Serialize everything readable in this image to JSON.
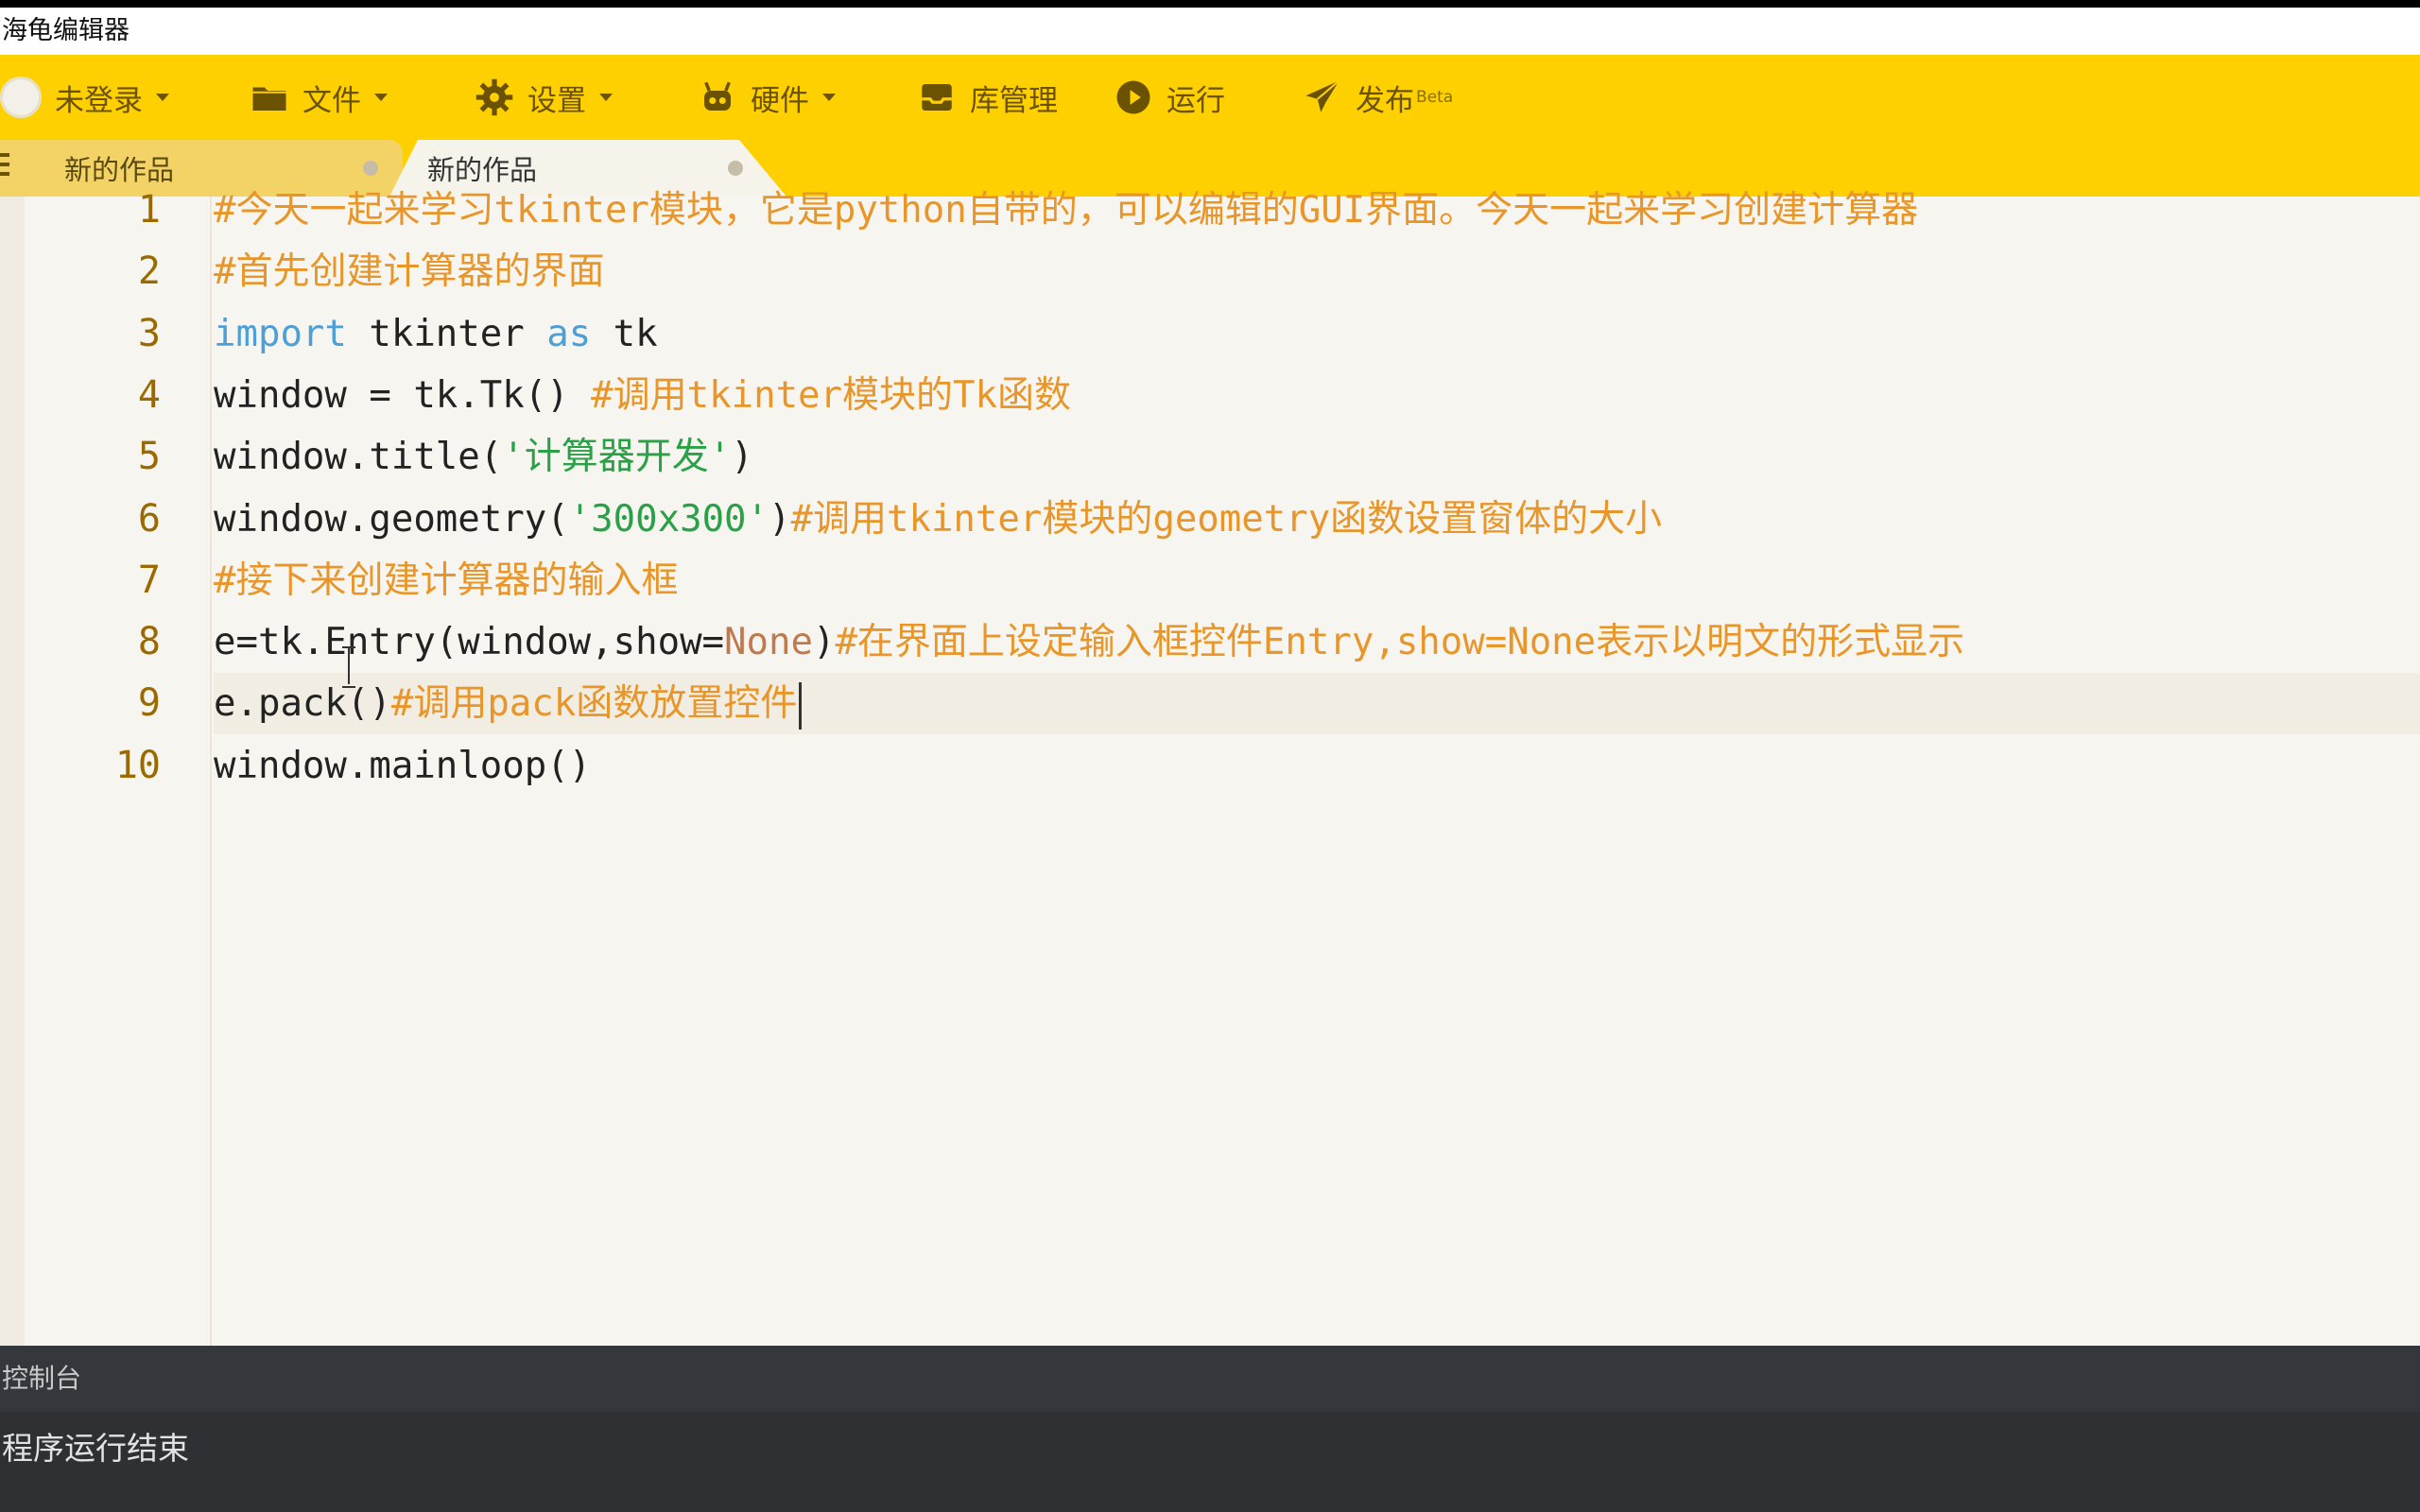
{
  "window": {
    "title": "海龟编辑器"
  },
  "toolbar": {
    "user": {
      "label": "未登录"
    },
    "file": {
      "label": "文件"
    },
    "settings": {
      "label": "设置"
    },
    "hardware": {
      "label": "硬件"
    },
    "library": {
      "label": "库管理"
    },
    "run": {
      "label": "运行"
    },
    "publish": {
      "label": "发布",
      "badge": "Beta"
    },
    "accent_color": "#ffd000"
  },
  "tabs": [
    {
      "label": "新的作品",
      "active": false
    },
    {
      "label": "新的作品",
      "active": true
    }
  ],
  "editor": {
    "line_numbers": [
      "1",
      "2",
      "3",
      "4",
      "5",
      "6",
      "7",
      "8",
      "9",
      "10"
    ],
    "lines": [
      [
        {
          "t": "#今天一起来学习tkinter模块，它是python自带的，可以编辑的GUI界面。今天一起来学习创建计算器",
          "k": "comment"
        }
      ],
      [
        {
          "t": "#首先创建计算器的界面",
          "k": "comment"
        }
      ],
      [
        {
          "t": "import",
          "k": "keyword"
        },
        {
          "t": " tkinter ",
          "k": "plain"
        },
        {
          "t": "as",
          "k": "keyword"
        },
        {
          "t": " tk",
          "k": "plain"
        }
      ],
      [
        {
          "t": "window = tk.Tk() ",
          "k": "plain"
        },
        {
          "t": "#调用tkinter模块的Tk函数",
          "k": "comment"
        }
      ],
      [
        {
          "t": "window.title(",
          "k": "plain"
        },
        {
          "t": "'计算器开发'",
          "k": "string"
        },
        {
          "t": ")",
          "k": "plain"
        }
      ],
      [
        {
          "t": "window.geometry(",
          "k": "plain"
        },
        {
          "t": "'300x300'",
          "k": "string"
        },
        {
          "t": ")",
          "k": "plain"
        },
        {
          "t": "#调用tkinter模块的geometry函数设置窗体的大小",
          "k": "comment"
        }
      ],
      [
        {
          "t": "#接下来创建计算器的输入框",
          "k": "comment"
        }
      ],
      [
        {
          "t": "e=tk.Entry(window,show=",
          "k": "plain"
        },
        {
          "t": "None",
          "k": "none"
        },
        {
          "t": ")",
          "k": "plain"
        },
        {
          "t": "#在界面上设定输入框控件Entry,show=None表示以明文的形式显示",
          "k": "comment"
        }
      ],
      [
        {
          "t": "e.pack()",
          "k": "plain"
        },
        {
          "t": "#调用pack函数放置控件",
          "k": "comment"
        }
      ],
      [
        {
          "t": "window.mainloop()",
          "k": "plain"
        }
      ]
    ],
    "active_line": 9
  },
  "console": {
    "title": "控制台",
    "output": "程序运行结束"
  }
}
